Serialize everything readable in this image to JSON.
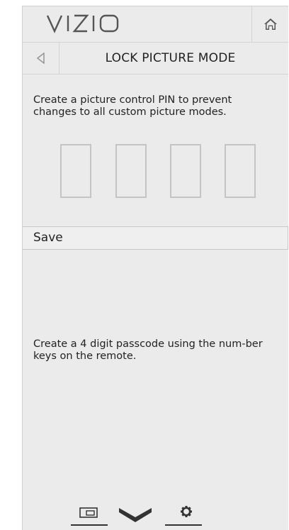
{
  "header": {
    "logo_text": "VIZIO",
    "home_icon": "home-icon"
  },
  "titlebar": {
    "back_icon": "back-arrow-icon",
    "title": "LOCK PICTURE MODE"
  },
  "main": {
    "description": "Create a picture control PIN to prevent changes to all custom picture modes.",
    "pin_boxes": [
      "",
      "",
      "",
      ""
    ],
    "save_label": "Save",
    "hint": "Create a 4 digit passcode using the num-ber keys on the remote."
  },
  "bottom_nav": {
    "items": [
      {
        "icon": "input-icon"
      },
      {
        "icon": "chevron-down-icon"
      },
      {
        "icon": "gear-icon"
      }
    ]
  },
  "colors": {
    "panel_bg": "#ebebeb",
    "border": "#d4d4d4",
    "pin_border": "#c4c4c4",
    "text": "#222222",
    "icon": "#555555"
  }
}
